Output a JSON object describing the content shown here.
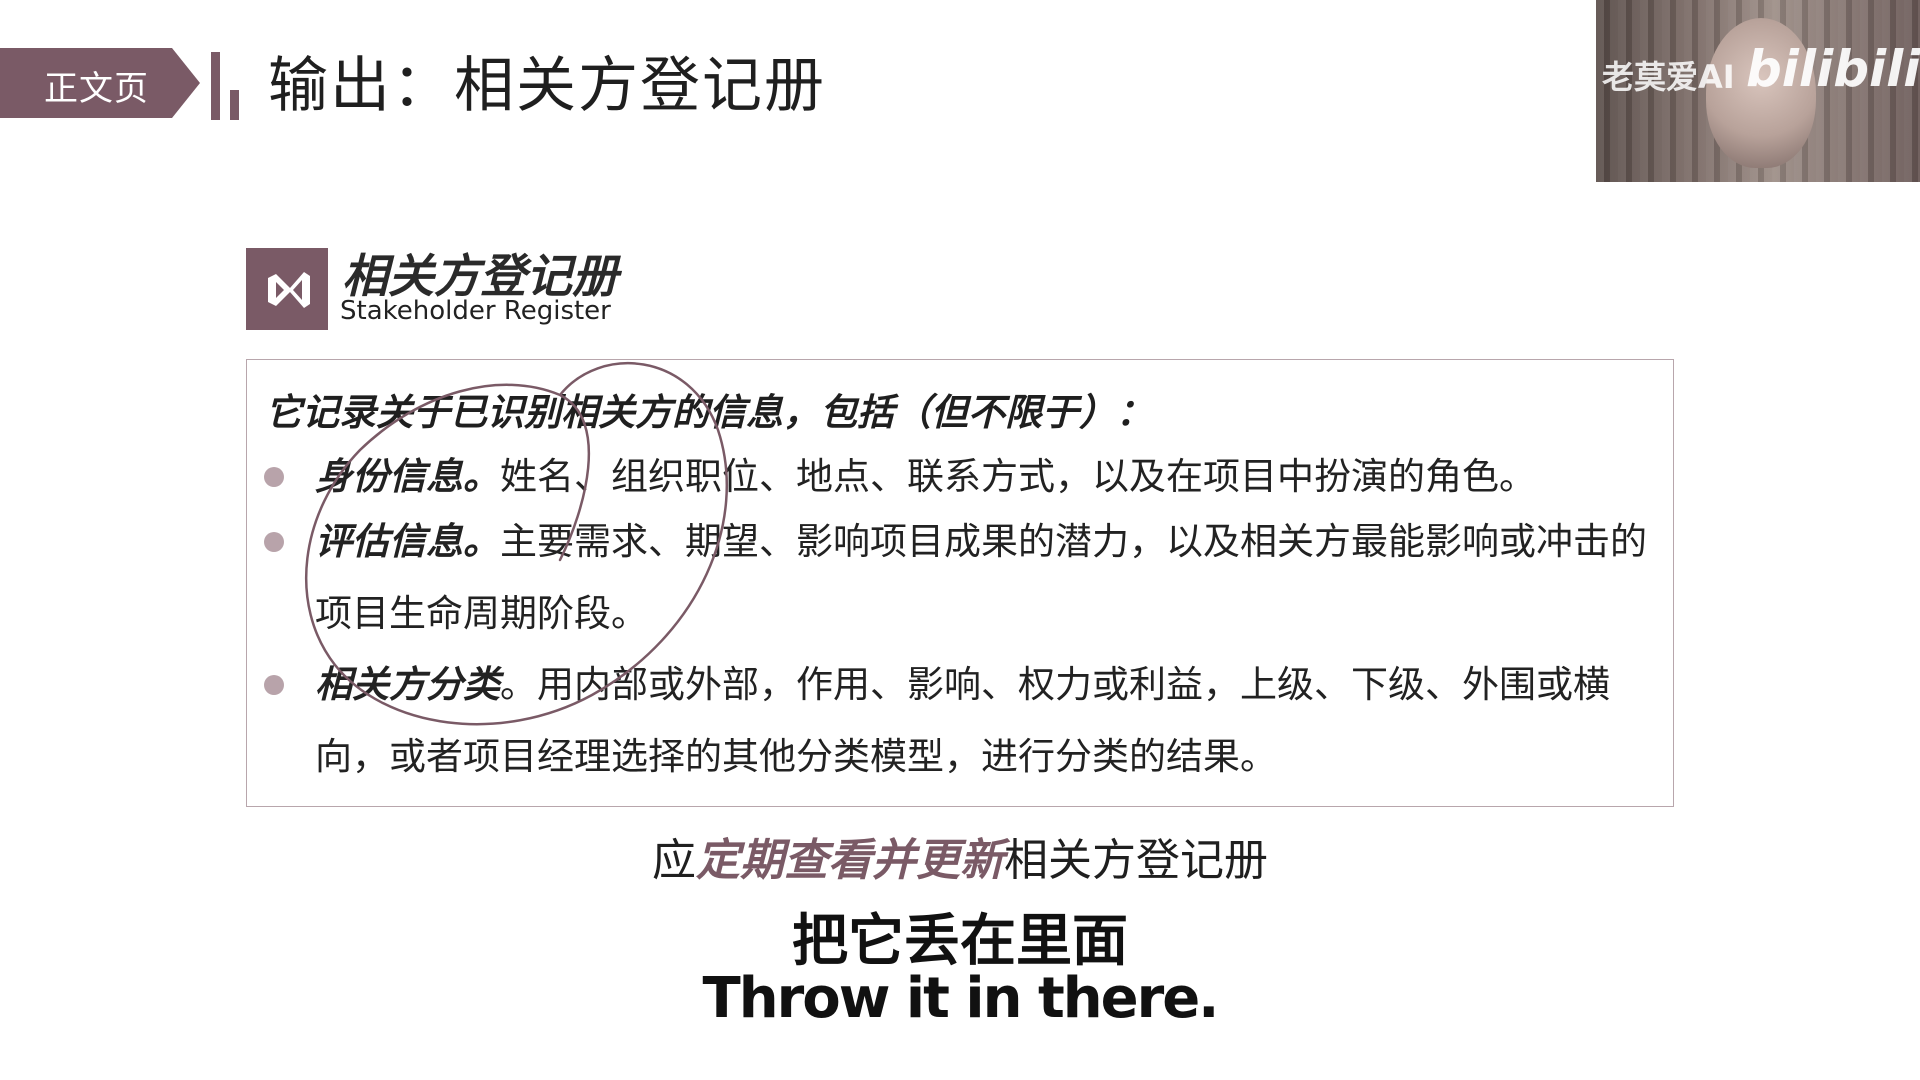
{
  "header": {
    "section_tag": "正文页",
    "title": "输出：相关方登记册"
  },
  "webcam": {
    "watermark_text": "老莫爱AI",
    "watermark_logo": "bilibili"
  },
  "register": {
    "icon": "visual-studio-logo-icon",
    "title": "相关方登记册",
    "subtitle": "Stakeholder Register"
  },
  "content": {
    "intro": "它记录关于已识别相关方的信息，包括（但不限于）：",
    "items": [
      {
        "key": "身份信息。",
        "text": "姓名、组织职位、地点、联系方式，以及在项目中扮演的角色。"
      },
      {
        "key": "评估信息。",
        "text": "主要需求、期望、影响项目成果的潜力，以及相关方最能影响或冲击的项目生命周期阶段。"
      },
      {
        "key": "相关方分类",
        "text": "。用内部或外部，作用、影响、权力或利益，上级、下级、外围或横向，或者项目经理选择的其他分类模型，进行分类的结果。"
      }
    ]
  },
  "note": {
    "prefix": "应",
    "emphasis": "定期查看并更新",
    "suffix": "相关方登记册"
  },
  "subtitles": {
    "chinese": "把它丢在里面",
    "english": "Throw it in there."
  },
  "colors": {
    "accent": "#7a5a66",
    "bullet": "#b8a3aa",
    "border": "#b8a6ac",
    "annotation": "#7a5a66"
  }
}
